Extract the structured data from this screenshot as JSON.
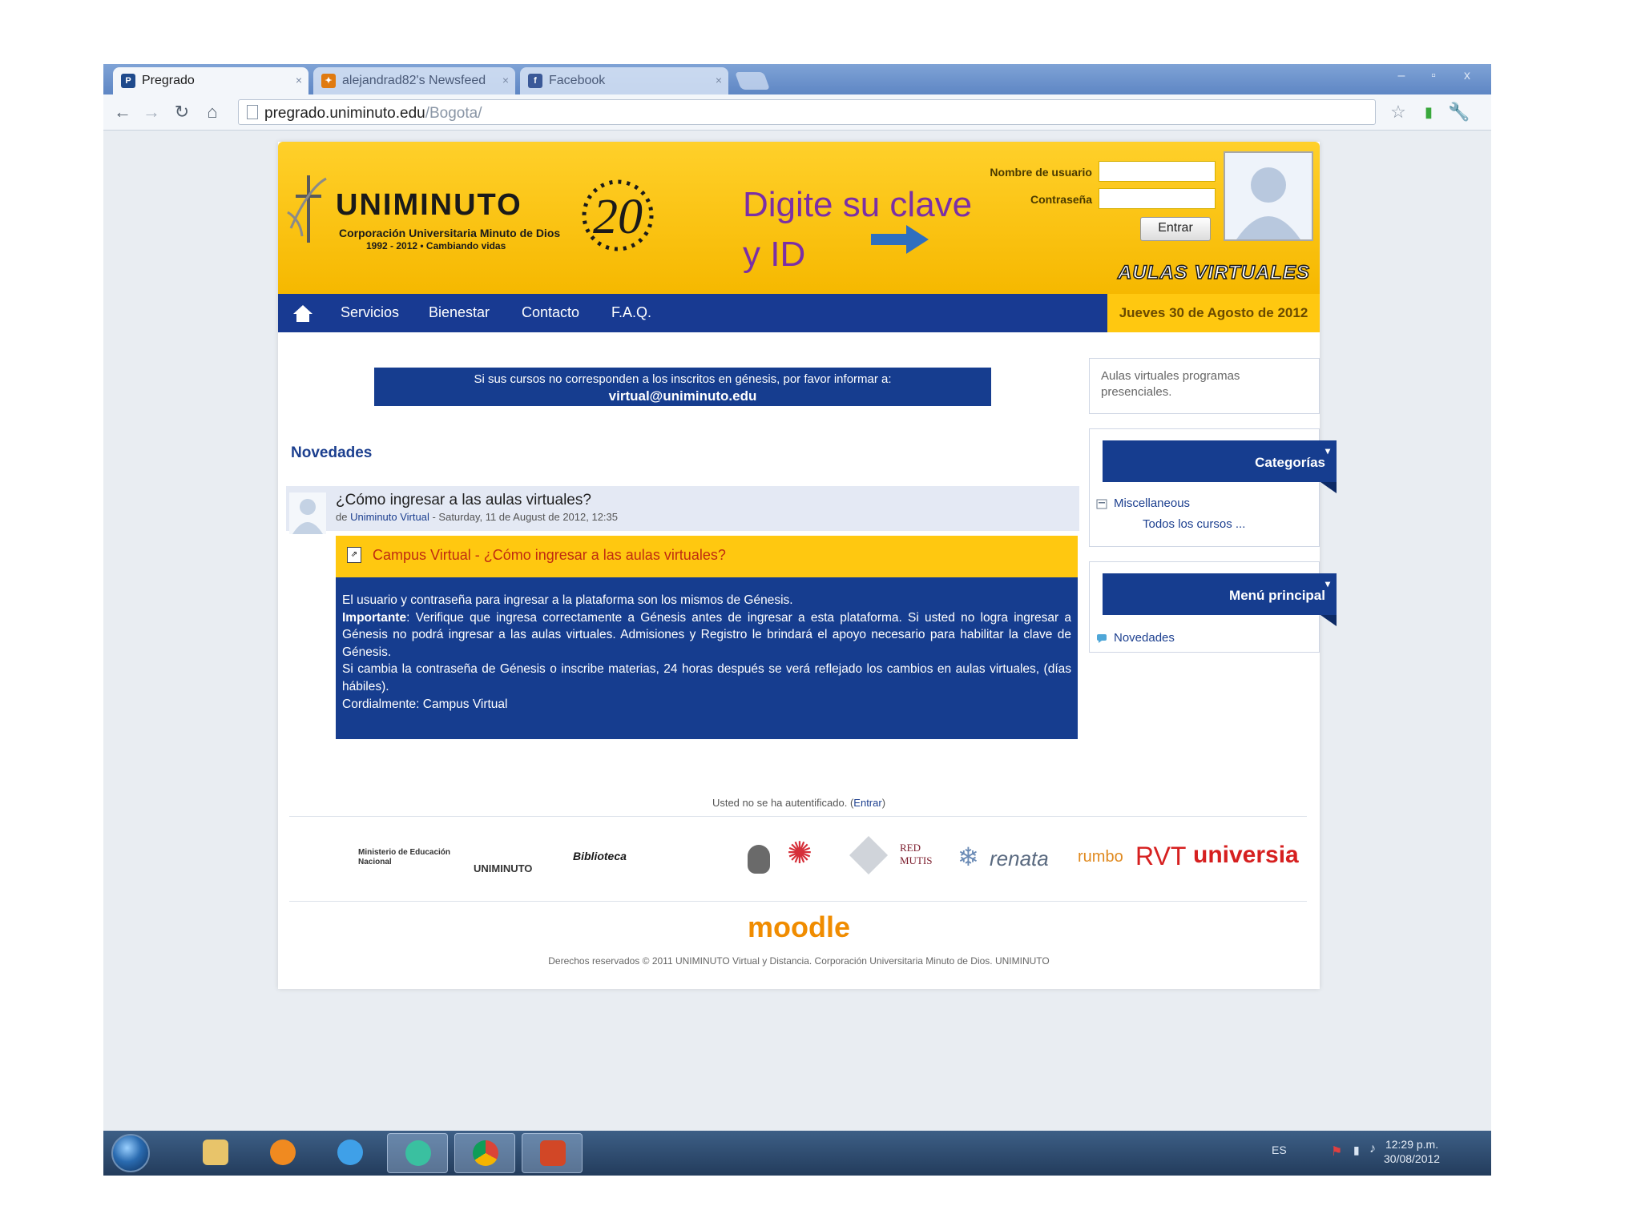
{
  "browser": {
    "tabs": [
      {
        "label": "Pregrado",
        "active": true,
        "icon": "pregrado-favicon"
      },
      {
        "label": "alejandrad82's Newsfeed",
        "active": false,
        "icon": "newsfeed-favicon"
      },
      {
        "label": "Facebook",
        "active": false,
        "icon": "facebook-favicon"
      }
    ],
    "url_host": "pregrado.uniminuto.edu",
    "url_path": "/Bogota/",
    "window_controls": {
      "minimize": "–",
      "restore": "▫",
      "close": "x"
    }
  },
  "header": {
    "logo_text": "UNIMINUTO",
    "logo_sub1": "Corporación Universitaria Minuto de Dios",
    "logo_sub2": "1992 - 2012  •  Cambiando vidas",
    "anniversary": "20",
    "annotation_line1": "Digite su clave",
    "annotation_line2": "y ID",
    "username_label": "Nombre de usuario",
    "password_label": "Contraseña",
    "username_value": "",
    "password_value": "",
    "login_button": "Entrar",
    "aulas_logo": "Aulas Virtuales"
  },
  "nav": {
    "items": [
      "Servicios",
      "Bienestar",
      "Contacto",
      "F.A.Q."
    ],
    "date": "Jueves 30 de Agosto de 2012"
  },
  "notice": {
    "line1": "Si sus cursos no corresponden a los inscritos en génesis, por favor informar a:",
    "email": "virtual@uniminuto.edu"
  },
  "main": {
    "section_title": "Novedades",
    "post": {
      "title": "¿Cómo ingresar a las aulas virtuales?",
      "meta_prefix": "de",
      "author": "Uniminuto Virtual",
      "meta_date": " - Saturday, 11 de August de 2012, 12:35",
      "banner": "Campus Virtual - ¿Cómo ingresar a las aulas virtuales?",
      "body_line1": "El usuario y contraseña para ingresar a la plataforma son los mismos de Génesis.",
      "body_important_label": "Importante",
      "body_important_text": ": Verifique que ingresa correctamente a Génesis antes de ingresar a esta plataforma. Si usted no logra ingresar a Génesis no podrá ingresar a las aulas virtuales. Admisiones y Registro le brindará el apoyo necesario para habilitar la clave de Génesis.",
      "body_line3": "Si cambia la contraseña de Génesis o inscribe materias, 24 horas después se verá reflejado los cambios en aulas virtuales, (días hábiles).",
      "body_line4": "Cordialmente: Campus Virtual"
    }
  },
  "sidebar": {
    "aulas_text": "Aulas virtuales programas presenciales.",
    "categories_title": "Categorías",
    "categories_item": "Miscellaneous",
    "categories_all": "Todos los cursos ...",
    "menu_title": "Menú principal",
    "menu_item": "Novedades"
  },
  "footer": {
    "auth_text": "Usted no se ha autentificado. (",
    "auth_link": "Entrar",
    "auth_close": ")",
    "partners": [
      "Ministerio de Educación Nacional",
      "UNIMINUTO",
      "Biblioteca",
      "RED MUTIS",
      "renata",
      "rumbo",
      "RVT",
      "universia"
    ],
    "moodle": "moodle",
    "copyright": "Derechos reservados © 2011 UNIMINUTO Virtual y Distancia. Corporación Universitaria Minuto de Dios. UNIMINUTO"
  },
  "taskbar": {
    "lang": "ES",
    "time": "12:29 p.m.",
    "date": "30/08/2012"
  },
  "colors": {
    "header_yellow": "#ffc810",
    "nav_blue": "#183a92",
    "annotation_purple": "#7b2fa6",
    "arrow_blue": "#2f6fbf"
  }
}
